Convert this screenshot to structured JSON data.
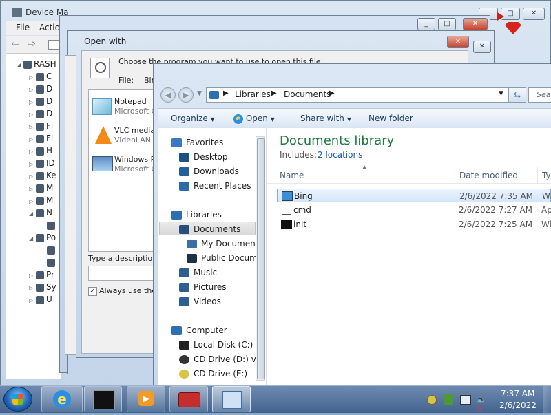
{
  "device_manager": {
    "title": "Device Ma",
    "menu": [
      "File",
      "Actio"
    ],
    "tree_root": "RASH",
    "tree_items": [
      "C",
      "D",
      "D",
      "D",
      "Fl",
      "Fl",
      "H",
      "ID",
      "Ke",
      "M",
      "M",
      "N",
      "Po",
      "Pr",
      "Sy",
      "U"
    ]
  },
  "open_with": {
    "title": "Open with",
    "instruction": "Choose the program you want to use to open this file:",
    "file_label": "File:",
    "file_name": "Bin",
    "programs": [
      {
        "name": "Notepad",
        "publisher": "Microsoft C"
      },
      {
        "name": "VLC media p",
        "publisher": "VideoLAN"
      },
      {
        "name": "Windows Ph",
        "publisher": "Microsoft C"
      }
    ],
    "description_label": "Type a description t",
    "always_use_label": "Always use the s"
  },
  "explorer": {
    "breadcrumb": [
      "Libraries",
      "Documents"
    ],
    "search_placeholder": "Sear",
    "toolbar": {
      "organize": "Organize",
      "open": "Open",
      "share": "Share with",
      "new_folder": "New folder"
    },
    "nav": {
      "favorites": "Favorites",
      "desktop": "Desktop",
      "downloads": "Downloads",
      "recent": "Recent Places",
      "libraries": "Libraries",
      "documents": "Documents",
      "my_documents": "My Documents",
      "public_documents": "Public Docume",
      "music": "Music",
      "pictures": "Pictures",
      "videos": "Videos",
      "computer": "Computer",
      "local_disk": "Local Disk (C:)",
      "cd_d": "CD Drive (D:) virt",
      "cd_e": "CD Drive (E:)"
    },
    "library_title": "Documents library",
    "includes_label": "Includes:",
    "includes_link": "2 locations",
    "columns": {
      "name": "Name",
      "date": "Date modified",
      "type": "Ty"
    },
    "files": [
      {
        "name": "Bing",
        "date": "2/6/2022 7:35 AM",
        "type": "Wi"
      },
      {
        "name": "cmd",
        "date": "2/6/2022 7:27 AM",
        "type": "Ap"
      },
      {
        "name": "init",
        "date": "2/6/2022 7:25 AM",
        "type": "Wi"
      }
    ]
  },
  "taskbar": {
    "time": "7:37 AM",
    "date": "2/6/2022"
  }
}
